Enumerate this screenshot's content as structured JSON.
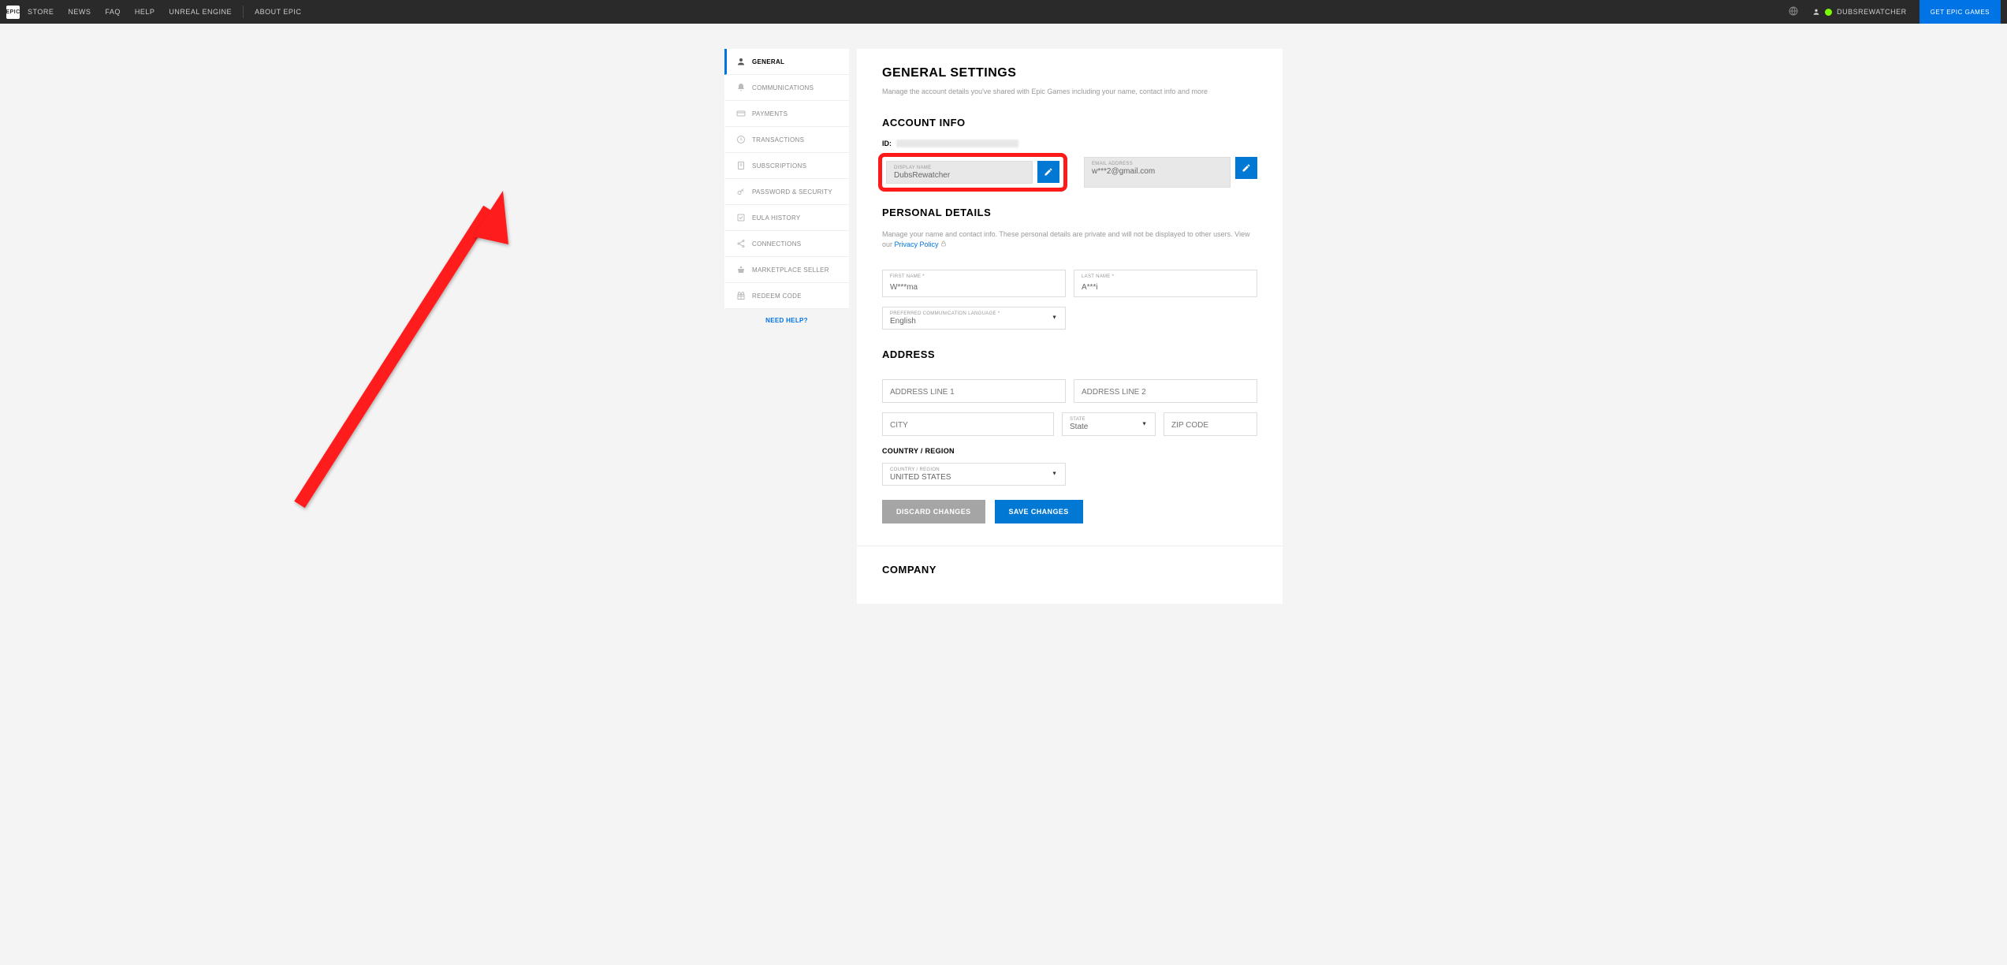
{
  "topbar": {
    "logo_text": "EPIC",
    "nav": [
      "STORE",
      "NEWS",
      "FAQ",
      "HELP",
      "UNREAL ENGINE"
    ],
    "about": "ABOUT EPIC",
    "username": "DUBSREWATCHER",
    "cta": "GET EPIC GAMES"
  },
  "sidebar": {
    "items": [
      {
        "label": "GENERAL",
        "icon": "person"
      },
      {
        "label": "COMMUNICATIONS",
        "icon": "bell"
      },
      {
        "label": "PAYMENTS",
        "icon": "card"
      },
      {
        "label": "TRANSACTIONS",
        "icon": "history"
      },
      {
        "label": "SUBSCRIPTIONS",
        "icon": "doc"
      },
      {
        "label": "PASSWORD & SECURITY",
        "icon": "key"
      },
      {
        "label": "EULA HISTORY",
        "icon": "check"
      },
      {
        "label": "CONNECTIONS",
        "icon": "share"
      },
      {
        "label": "MARKETPLACE SELLER",
        "icon": "seller"
      },
      {
        "label": "REDEEM CODE",
        "icon": "gift"
      }
    ],
    "help": "NEED HELP?"
  },
  "main": {
    "title": "GENERAL SETTINGS",
    "subtitle": "Manage the account details you've shared with Epic Games including your name, contact info and more",
    "account": {
      "heading": "ACCOUNT INFO",
      "id_label": "ID:",
      "display_name_label": "DISPLAY NAME",
      "display_name": "DubsRewatcher",
      "email_label": "EMAIL ADDRESS",
      "email": "w***2@gmail.com"
    },
    "personal": {
      "heading": "PERSONAL DETAILS",
      "subtitle": "Manage your name and contact info. These personal details are private and will not be displayed to other users. View our ",
      "privacy": "Privacy Policy",
      "first_name_label": "FIRST NAME *",
      "first_name": "W***ma",
      "last_name_label": "LAST NAME *",
      "last_name": "A***i",
      "lang_label": "PREFERRED COMMUNICATION LANGUAGE *",
      "lang": "English"
    },
    "address": {
      "heading": "ADDRESS",
      "line1": "ADDRESS LINE 1",
      "line2": "ADDRESS LINE 2",
      "city": "CITY",
      "state_label": "STATE",
      "state": "State",
      "zip": "ZIP CODE",
      "country_heading": "COUNTRY / REGION",
      "country_label": "COUNTRY / REGION",
      "country": "UNITED STATES"
    },
    "buttons": {
      "discard": "DISCARD CHANGES",
      "save": "SAVE CHANGES"
    },
    "company": {
      "heading": "COMPANY"
    }
  }
}
